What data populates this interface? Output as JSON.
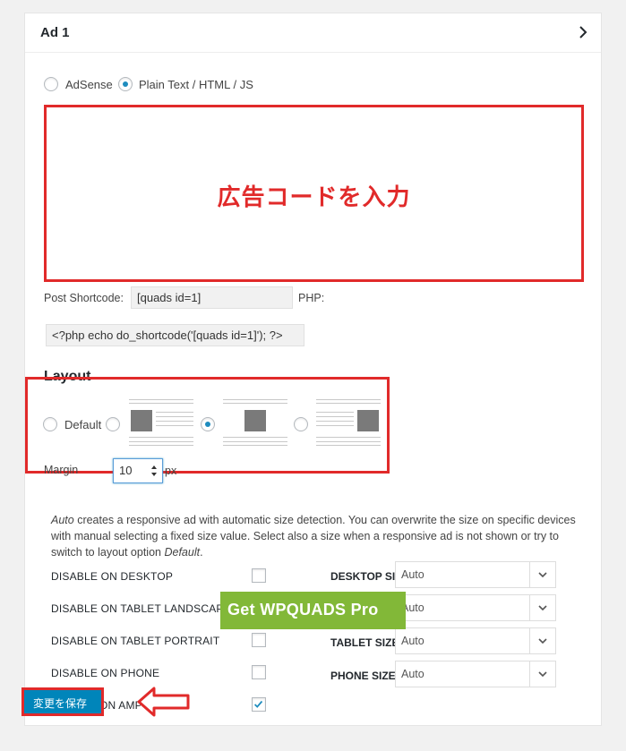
{
  "panel": {
    "title": "Ad 1"
  },
  "ad_type": {
    "options": [
      "AdSense",
      "Plain Text / HTML / JS"
    ],
    "selected": "Plain Text / HTML / JS"
  },
  "code_area": {
    "overlay_text": "広告コードを入力"
  },
  "shortcode": {
    "post_label": "Post Shortcode:",
    "post_value": "[quads id=1]",
    "php_label": "PHP:",
    "php_value": "<?php echo do_shortcode('[quads id=1]'); ?>"
  },
  "layout": {
    "heading": "Layout",
    "default_label": "Default",
    "options": [
      "Default",
      "left",
      "center",
      "right"
    ],
    "selected": "center",
    "margin_label": "Margin",
    "margin_value": "10",
    "margin_unit": "px"
  },
  "description": {
    "auto_word": "Auto",
    "text_part1": " creates a responsive ad with automatic size detection. You can overwrite the size on specific devices with manual selecting a fixed size value. Select also a size when a responsive ad is not shown or try to switch to layout option ",
    "default_word": "Default",
    "text_end": "."
  },
  "disable_options": [
    {
      "label": "DISABLE ON DESKTOP",
      "checked": false
    },
    {
      "label": "DISABLE ON TABLET LANDSCAPE",
      "checked": false
    },
    {
      "label": "DISABLE ON TABLET PORTRAIT",
      "checked": false
    },
    {
      "label": "DISABLE ON PHONE",
      "checked": false
    },
    {
      "label": "ON AMP",
      "checked": true
    }
  ],
  "sizes": [
    {
      "label": "DESKTOP SIZE:",
      "value": "Auto"
    },
    {
      "label": "",
      "value": "Auto"
    },
    {
      "label": "TABLET SIZE:",
      "value": "Auto"
    },
    {
      "label": "PHONE SIZE:",
      "value": "Auto"
    }
  ],
  "promo": {
    "text": "Get WPQUADS Pro"
  },
  "save": {
    "label": "変更を保存"
  },
  "colors": {
    "accent_red": "#e12a2a",
    "primary_blue": "#0085ba",
    "promo_green": "#82b838"
  }
}
